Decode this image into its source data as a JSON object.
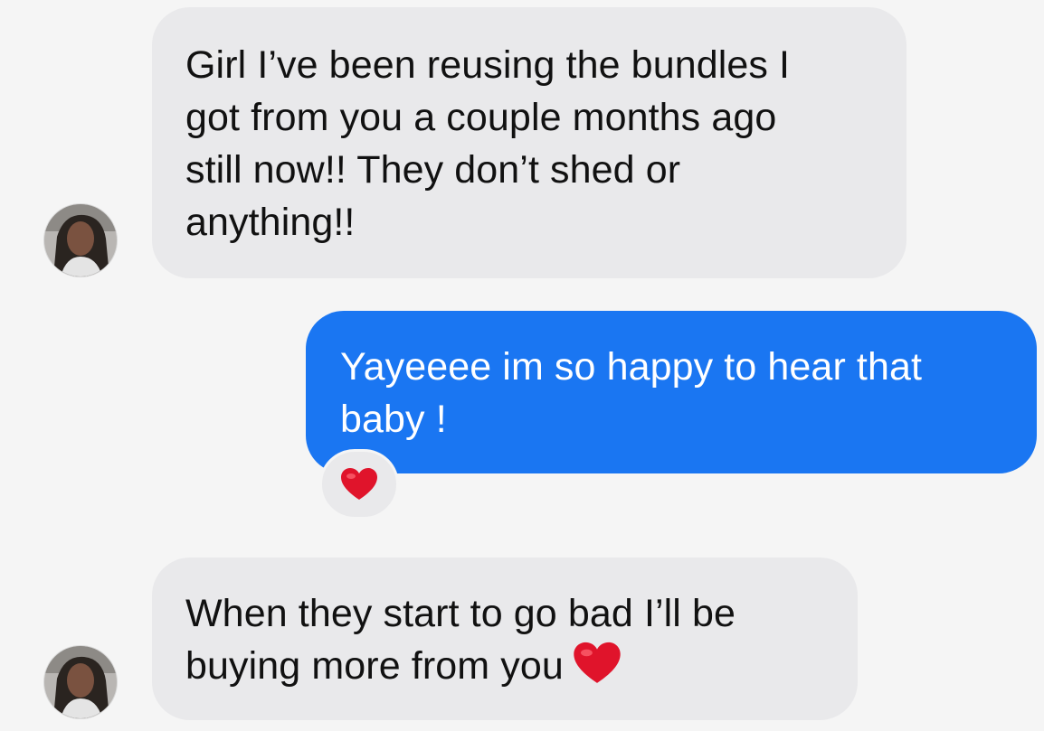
{
  "messages": [
    {
      "direction": "incoming",
      "lines": [
        "Girl I’ve been reusing the bundles I",
        "got from you a couple months ago",
        "still now!! They don’t shed or",
        "anything!!"
      ]
    },
    {
      "direction": "outgoing",
      "lines": [
        "Yayeeee im so happy to hear that",
        "baby !"
      ],
      "reaction": "heart-icon"
    },
    {
      "direction": "incoming",
      "lines": [
        "When they start to go bad I’ll be",
        "buying more from you"
      ],
      "trailing_emoji": "heart-icon"
    }
  ],
  "colors": {
    "background": "#f5f5f5",
    "incoming_bubble": "#e9e9eb",
    "outgoing_bubble": "#1a76f2",
    "heart": "#e0142b"
  }
}
